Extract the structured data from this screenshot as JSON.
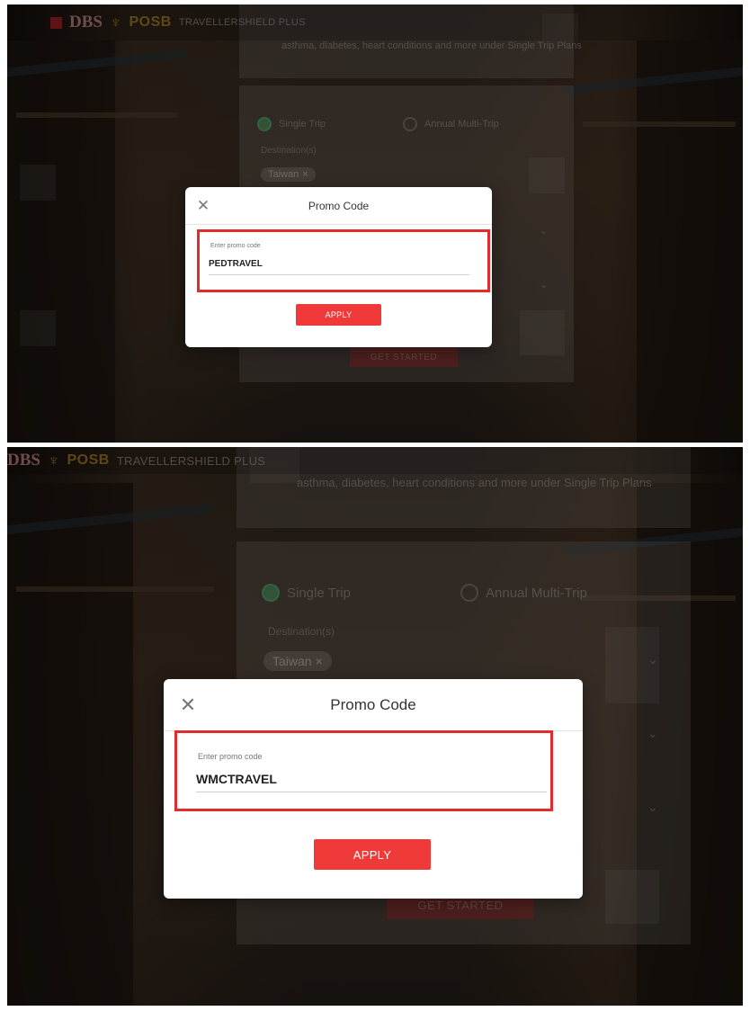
{
  "brand": {
    "dbs": "DBS",
    "posb": "POSB",
    "product": "TRAVELLERSHIELD PLUS",
    "dbs_color": "#c2272d",
    "posb_color": "#d4a32b"
  },
  "form": {
    "note": "asthma, diabetes, heart conditions and more under Single Trip Plans",
    "trip_single": "Single Trip",
    "trip_annual": "Annual Multi-Trip",
    "destinations_label": "Destination(s)",
    "destination_chip": "Taiwan",
    "get_started": "GET STARTED"
  },
  "modal_top": {
    "title": "Promo Code",
    "close_icon": "close-icon",
    "input_label": "Enter promo code",
    "input_value": "PEDTRAVEL",
    "apply_label": "APPLY"
  },
  "modal_bottom": {
    "title": "Promo Code",
    "close_icon": "close-icon",
    "input_label": "Enter promo code",
    "input_value": "WMCTRAVEL",
    "apply_label": "APPLY"
  },
  "colors": {
    "accent": "#f03a3a",
    "highlight_border": "#e32b2b",
    "selected_radio": "#5abe78"
  }
}
